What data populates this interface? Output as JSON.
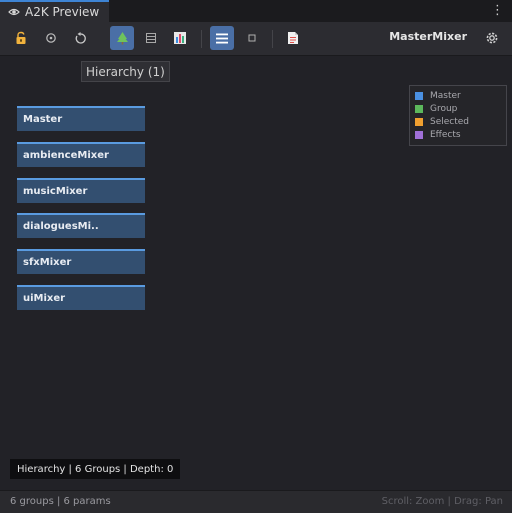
{
  "window": {
    "tab_title": "A2K Preview",
    "tab_icon": "eye-icon",
    "menu_icon": "kebab-menu-icon"
  },
  "toolbar": {
    "buttons": [
      {
        "name": "lock-icon",
        "active": false
      },
      {
        "name": "record-icon",
        "active": false
      },
      {
        "name": "refresh-icon",
        "active": false
      },
      {
        "name": "tree-icon",
        "active": true
      },
      {
        "name": "list-icon",
        "active": false
      },
      {
        "name": "chart-icon",
        "active": false
      },
      {
        "name": "menu-lines-icon",
        "active": true
      },
      {
        "name": "square-icon",
        "active": false
      },
      {
        "name": "document-icon",
        "active": false
      },
      {
        "name": "settings-icon",
        "active": false
      }
    ],
    "mixer_name": "MasterMixer"
  },
  "view": {
    "label": "Hierarchy (1)"
  },
  "legend": {
    "items": [
      {
        "label": "Master",
        "color": "#4a90e2"
      },
      {
        "label": "Group",
        "color": "#5cb85c"
      },
      {
        "label": "Selected",
        "color": "#f0a030"
      },
      {
        "label": "Effects",
        "color": "#a070d8"
      }
    ]
  },
  "nodes": [
    "Master",
    "ambienceMixer",
    "musicMixer",
    "dialoguesMi..",
    "sfxMixer",
    "uiMixer"
  ],
  "status": {
    "overlay": "Hierarchy | 6 Groups | Depth: 0"
  },
  "footer": {
    "left": "6 groups | 6 params",
    "right": "Scroll: Zoom | Drag: Pan"
  },
  "colors": {
    "accent": "#3e84d4",
    "node_fill": "#334f70",
    "node_border": "#5a9be0",
    "background": "#222227"
  }
}
